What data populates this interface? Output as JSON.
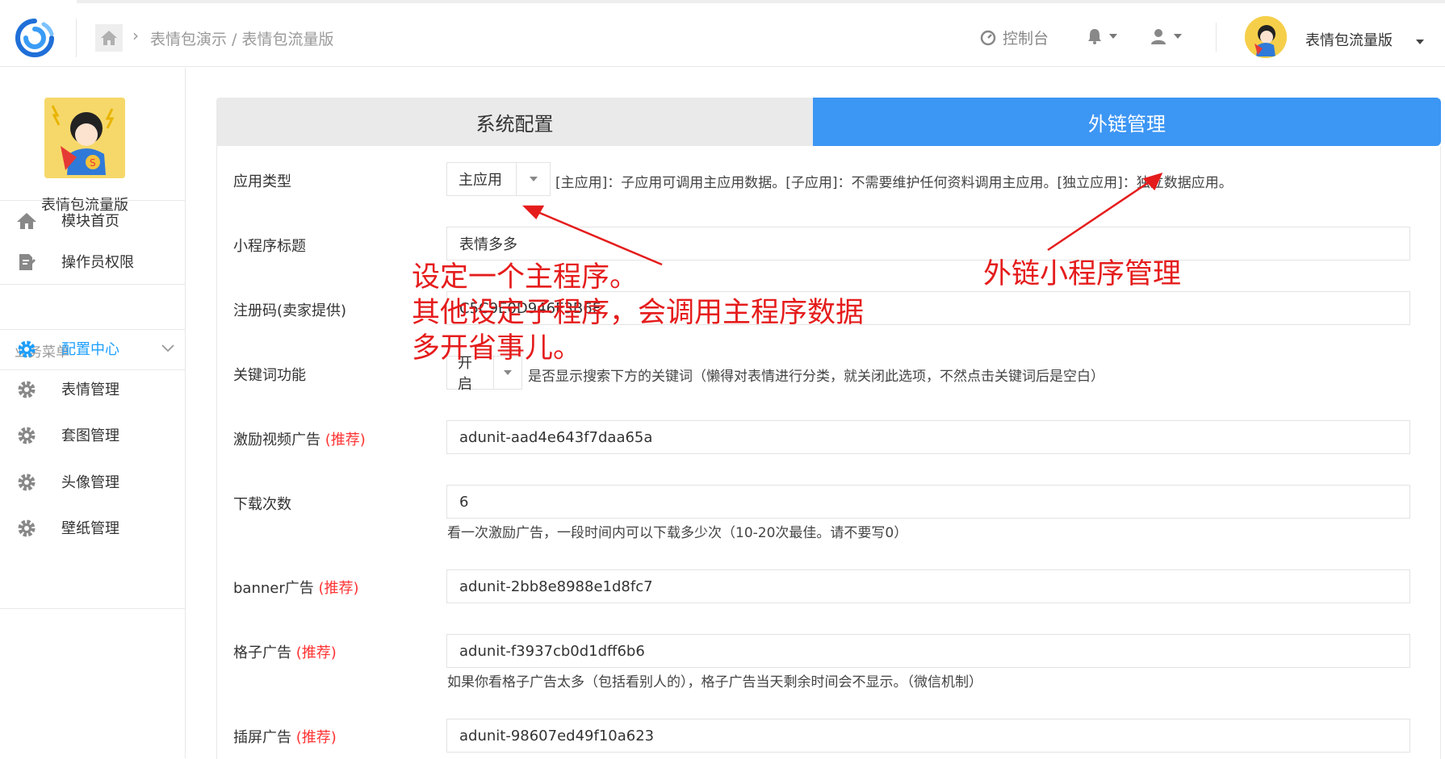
{
  "header": {
    "breadcrumb": "表情包演示 / 表情包流量版",
    "console_label": "控制台",
    "username": "表情包流量版"
  },
  "sidebar": {
    "profile_name": "表情包流量版",
    "items": [
      {
        "label": "模块首页",
        "icon": "home-icon"
      },
      {
        "label": "操作员权限",
        "icon": "edit-doc-icon"
      }
    ],
    "group_label": "业务菜单",
    "menu": [
      {
        "label": "配置中心",
        "icon": "gear-icon",
        "active": true
      },
      {
        "label": "表情管理",
        "icon": "gear-icon"
      },
      {
        "label": "套图管理",
        "icon": "gear-icon"
      },
      {
        "label": "头像管理",
        "icon": "gear-icon"
      },
      {
        "label": "壁纸管理",
        "icon": "gear-icon"
      }
    ]
  },
  "tabs": [
    {
      "label": "系统配置",
      "active": false
    },
    {
      "label": "外链管理",
      "active": true
    }
  ],
  "form": {
    "app_type": {
      "label": "应用类型",
      "value": "主应用",
      "desc": "[主应用]：子应用可调用主应用数据。[子应用]：不需要维护任何资料调用主应用。[独立应用]：独立数据应用。"
    },
    "title": {
      "label": "小程序标题",
      "value": "表情多多"
    },
    "reg_code": {
      "label": "注册码(卖家提供)",
      "value": "C5C9E0D946F3B6F"
    },
    "keyword": {
      "label": "关键词功能",
      "value": "开启",
      "desc": "是否显示搜索下方的关键词（懒得对表情进行分类，就关闭此选项，不然点击关键词后是空白）"
    },
    "reward_ad": {
      "label": "激励视频广告",
      "rec": "(推荐)",
      "value": "adunit-aad4e643f7daa65a"
    },
    "download_count": {
      "label": "下载次数",
      "value": "6",
      "desc": "看一次激励广告，一段时间内可以下载多少次（10-20次最佳。请不要写0）"
    },
    "banner_ad": {
      "label": "banner广告",
      "rec": "(推荐)",
      "value": "adunit-2bb8e8988e1d8fc7"
    },
    "grid_ad": {
      "label": "格子广告",
      "rec": "(推荐)",
      "value": "adunit-f3937cb0d1dff6b6",
      "desc": "如果你看格子广告太多（包括看别人的），格子广告当天剩余时间会不显示。（微信机制）"
    },
    "interstitial_ad": {
      "label": "插屏广告",
      "rec": "(推荐)",
      "value": "adunit-98607ed49f10a623"
    }
  },
  "annotations": {
    "left_lines": [
      "设定一个主程序。",
      "其他设定子程序，会调用主程序数据",
      "多开省事儿。"
    ],
    "right": "外链小程序管理",
    "color": "#e51c1c"
  },
  "colors": {
    "accent": "#1e9fff",
    "tab_active": "#3c96f4",
    "recommend": "#ff3333"
  }
}
